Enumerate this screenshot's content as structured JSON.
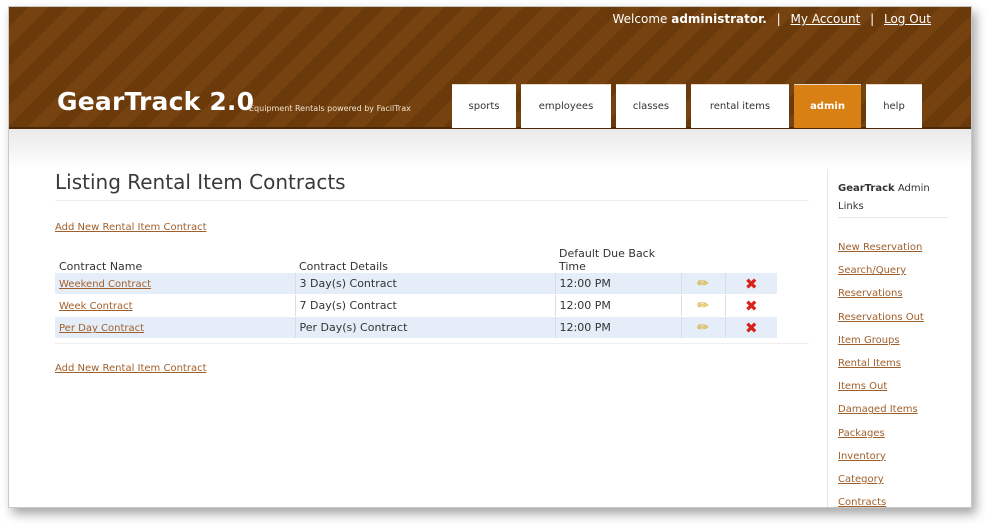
{
  "header": {
    "welcome_prefix": "Welcome",
    "username": "administrator.",
    "separator": "|",
    "my_account": "My Account",
    "log_out": "Log Out",
    "app_title": "GearTrack 2.0",
    "tagline": "Equipment Rentals powered by FacilTrax"
  },
  "tabs": [
    {
      "label": "sports"
    },
    {
      "label": "employees"
    },
    {
      "label": "classes"
    },
    {
      "label": "rental items"
    },
    {
      "label": "admin",
      "active": true
    },
    {
      "label": "help"
    }
  ],
  "page": {
    "title": "Listing Rental Item Contracts",
    "add_link": "Add New Rental Item Contract"
  },
  "table": {
    "columns": [
      "Contract Name",
      "Contract Details",
      "Default Due Back Time"
    ],
    "rows": [
      {
        "name": "Weekend Contract",
        "details": "3 Day(s) Contract",
        "time": "12:00 PM"
      },
      {
        "name": "Week Contract",
        "details": "7 Day(s) Contract",
        "time": "12:00 PM"
      },
      {
        "name": "Per Day Contract",
        "details": "Per Day(s) Contract",
        "time": "12:00 PM"
      }
    ]
  },
  "sidebar": {
    "title_bold": "GearTrack",
    "title_rest": "Admin Links",
    "links": [
      "New Reservation",
      "Search/Query",
      "Reservations",
      "Reservations Out",
      "Item Groups",
      "Rental Items",
      "Items Out",
      "Damaged Items",
      "Packages",
      "Inventory",
      "Category",
      "Contracts"
    ]
  },
  "colors": {
    "header_brown": "#6b3a0a",
    "active_tab": "#d98015",
    "link": "#a0602c",
    "row_highlight": "#e5eef8",
    "delete_red": "#d8221a",
    "edit_yellow": "#d6a41a"
  },
  "icons": {
    "edit": "pencil-icon",
    "delete": "red-x-icon"
  }
}
